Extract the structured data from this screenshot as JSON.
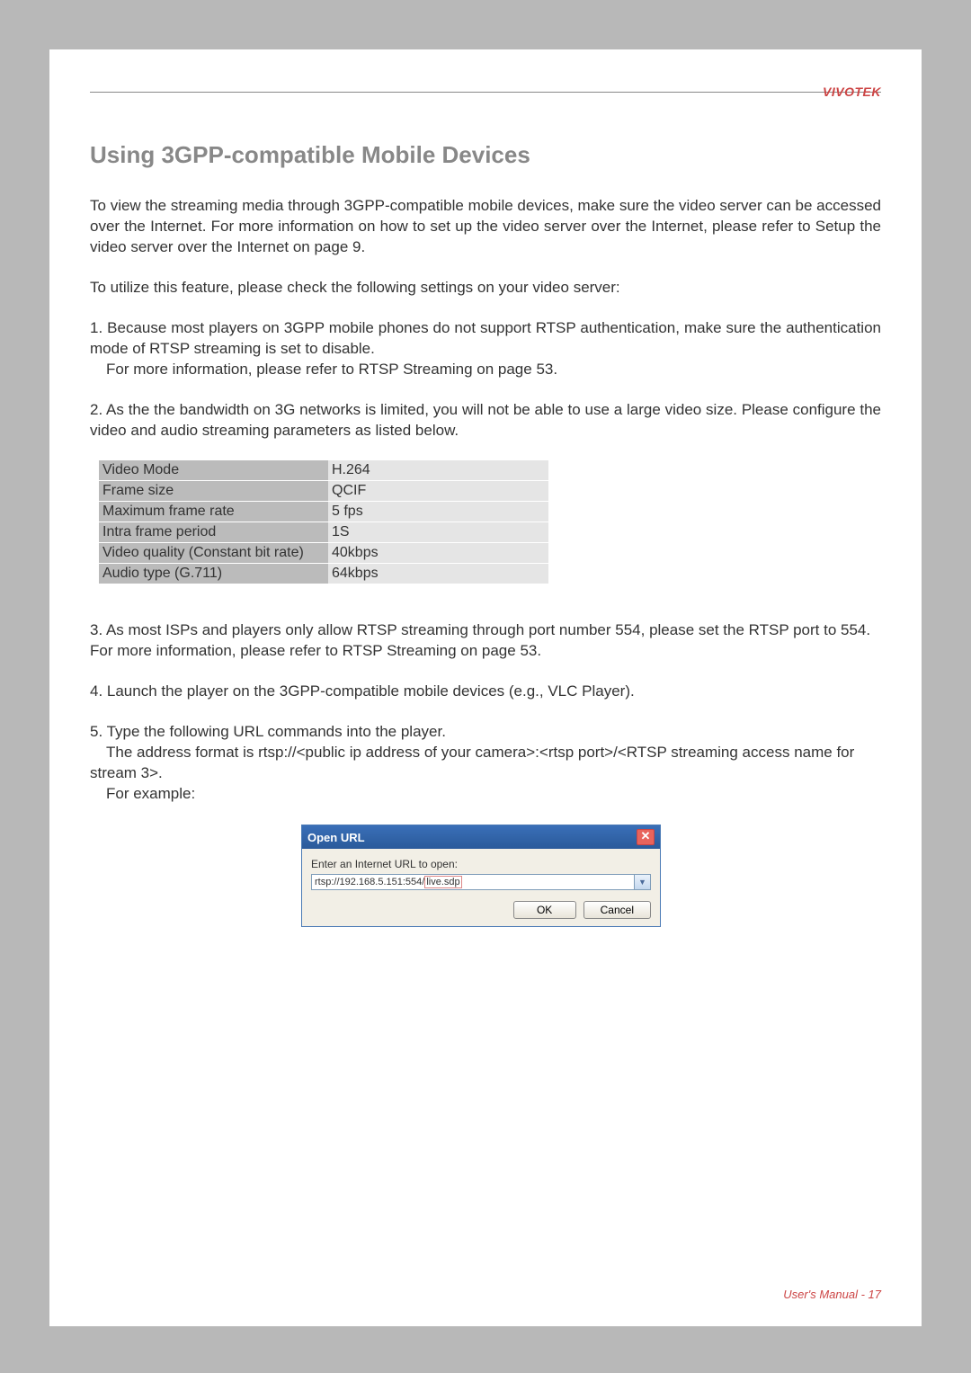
{
  "brand": "VIVOTEK",
  "heading": "Using 3GPP-compatible Mobile Devices",
  "intro_p1": "To view the streaming media through 3GPP-compatible mobile devices, make sure the video server can be accessed over the Internet. For more information on how to set up the video server over the Internet, please refer to Setup the video server over the Internet on page 9.",
  "intro_p2": "To utilize this feature, please check the following settings on your video server:",
  "item1_line1": "1. Because most players on 3GPP mobile phones do not support RTSP authentication, make sure the authentication mode of RTSP streaming is set to disable.",
  "item1_line2": "For more information, please refer to RTSP Streaming on page 53.",
  "item2_line1": "2. As the the bandwidth on 3G networks is limited, you will not be able to use a large video size. Please configure the video and audio streaming parameters as listed below.",
  "table": {
    "rows": [
      {
        "label": "Video Mode",
        "value": "H.264"
      },
      {
        "label": "Frame size",
        "value": "QCIF"
      },
      {
        "label": "Maximum frame rate",
        "value": "5 fps"
      },
      {
        "label": "Intra frame period",
        "value": "1S"
      },
      {
        "label": "Video quality (Constant bit rate)",
        "value": "40kbps"
      },
      {
        "label": "Audio type (G.711)",
        "value": "64kbps"
      }
    ]
  },
  "item3": "3. As most ISPs and players only allow RTSP streaming through port number 554, please set the RTSP port to 554. For more information, please refer to RTSP Streaming on page 53.",
  "item4": "4. Launch the player on the 3GPP-compatible mobile devices (e.g., VLC Player).",
  "item5_line1": "5. Type the following URL commands into the player.",
  "item5_line2": "The address format is rtsp://<public ip address of your camera>:<rtsp port>/<RTSP streaming access name for stream 3>.",
  "item5_line3": "For example:",
  "dialog": {
    "title": "Open URL",
    "label": "Enter an Internet URL to open:",
    "url_prefix": "rtsp://192.168.5.151:554/",
    "url_suffix": "live.sdp",
    "ok": "OK",
    "cancel": "Cancel"
  },
  "footer": "User's Manual - 17"
}
